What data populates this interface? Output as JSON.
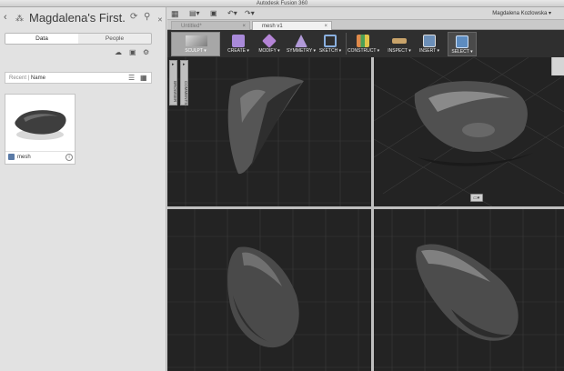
{
  "window": {
    "title": "Autodesk Fusion 360"
  },
  "data_panel": {
    "project_title": "Magdalena's First...",
    "tabs": [
      {
        "label": "Data",
        "active": true
      },
      {
        "label": "People",
        "active": false
      }
    ],
    "sort": {
      "prefix": "Recent |",
      "active": "Name"
    },
    "items": [
      {
        "name": "mesh",
        "info_icon": "info-icon"
      }
    ]
  },
  "app_bar": {
    "user_name": "Magdalena Kozlowska ▾"
  },
  "doc_tabs": [
    {
      "label": "Untitled*",
      "active": false,
      "close": "×"
    },
    {
      "label": "mesh v1",
      "active": true,
      "close": "×"
    }
  ],
  "toolbar": {
    "mode_label": "SCULPT ▾",
    "tools": [
      {
        "label": "CREATE ▾",
        "color": "#a98ad9"
      },
      {
        "label": "MODIFY ▾",
        "color": "#b484d6"
      },
      {
        "label": "SYMMETRY ▾",
        "color": "#b19ad8"
      },
      {
        "label": "SKETCH ▾",
        "color": "#8ab0e0"
      },
      {
        "label": "CONSTRUCT ▾",
        "color": "#e08a4a"
      },
      {
        "label": "INSPECT ▾",
        "color": "#c9a36a"
      },
      {
        "label": "INSERT ▾",
        "color": "#6c8fb8"
      },
      {
        "label": "SELECT ▾",
        "color": "#5d8cc0"
      }
    ]
  },
  "browser": {
    "label": "BROWSER",
    "comments_label": "COMMENTS"
  },
  "colors": {
    "toolbar_bg": "#2f2f2f",
    "viewport_bg": "#262626",
    "panel_bg": "#e2e2e2"
  }
}
